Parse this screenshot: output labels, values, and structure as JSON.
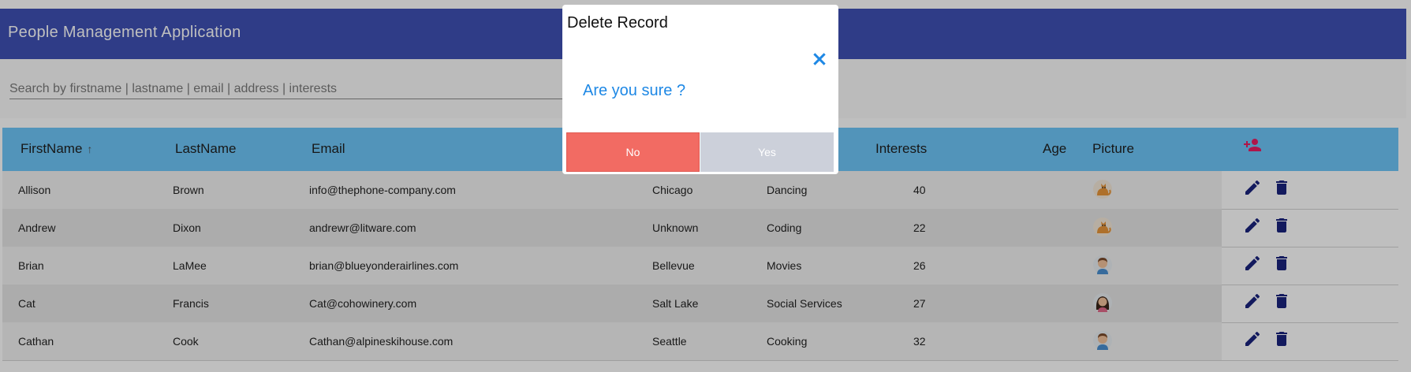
{
  "header": {
    "title": "People Management Application"
  },
  "search": {
    "placeholder": "Search by firstname | lastname | email | address | interests"
  },
  "table": {
    "columns": {
      "firstname": "FirstName",
      "lastname": "LastName",
      "email": "Email",
      "interests": "Interests",
      "age": "Age",
      "picture": "Picture"
    },
    "sort_indicator": "↑",
    "rows": [
      {
        "firstname": "Allison",
        "lastname": "Brown",
        "email": "info@thephone-company.com",
        "address": "Chicago",
        "interests": "Dancing",
        "age": "40",
        "picture": "cat-icon"
      },
      {
        "firstname": "Andrew",
        "lastname": "Dixon",
        "email": "andrewr@litware.com",
        "address": "Unknown",
        "interests": "Coding",
        "age": "22",
        "picture": "cat-icon"
      },
      {
        "firstname": "Brian",
        "lastname": "LaMee",
        "email": "brian@blueyonderairlines.com",
        "address": "Bellevue",
        "interests": "Movies",
        "age": "26",
        "picture": "man-icon"
      },
      {
        "firstname": "Cat",
        "lastname": "Francis",
        "email": "Cat@cohowinery.com",
        "address": "Salt Lake",
        "interests": "Social Services",
        "age": "27",
        "picture": "woman-icon"
      },
      {
        "firstname": "Cathan",
        "lastname": "Cook",
        "email": "Cathan@alpineskihouse.com",
        "address": "Seattle",
        "interests": "Cooking",
        "age": "32",
        "picture": "man-icon"
      }
    ]
  },
  "modal": {
    "title": "Delete Record",
    "message": "Are you sure ?",
    "no_label": "No",
    "yes_label": "Yes"
  },
  "colors": {
    "header": "#3f51b5",
    "table_header": "#6ec6f8",
    "add_user_icon": "#e91e63",
    "action_icon": "#1a237e",
    "no_button": "#f26b63",
    "yes_button": "#ccd0da",
    "message": "#1e88e5"
  }
}
